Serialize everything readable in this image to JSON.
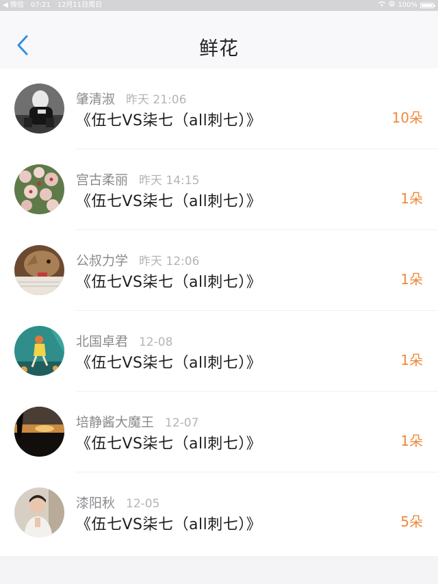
{
  "status_bar": {
    "carrier": "◀ 微信",
    "time": "07:21",
    "date": "12月11日周日",
    "battery": "100%"
  },
  "nav": {
    "title": "鲜花",
    "back_icon": "chevron-left-icon",
    "accent_color": "#2f8fe8"
  },
  "items": [
    {
      "name": "肇清淑",
      "time": "昨天 21:06",
      "work": "《伍七VS柒七（all刺七）》",
      "count": "10朵"
    },
    {
      "name": "宫古柔丽",
      "time": "昨天 14:15",
      "work": "《伍七VS柒七（all刺七）》",
      "count": "1朵"
    },
    {
      "name": "公叔力学",
      "time": "昨天 12:06",
      "work": "《伍七VS柒七（all刺七）》",
      "count": "1朵"
    },
    {
      "name": "北国卓君",
      "time": "12-08",
      "work": "《伍七VS柒七（all刺七）》",
      "count": "1朵"
    },
    {
      "name": "培静酱大魔王",
      "time": "12-07",
      "work": "《伍七VS柒七（all刺七）》",
      "count": "1朵"
    },
    {
      "name": "漆阳秋",
      "time": "12-05",
      "work": "《伍七VS柒七（all刺七）》",
      "count": "5朵"
    }
  ],
  "colors": {
    "count": "#f0883a",
    "name": "#8a8a8e",
    "time": "#b4b4b8"
  }
}
